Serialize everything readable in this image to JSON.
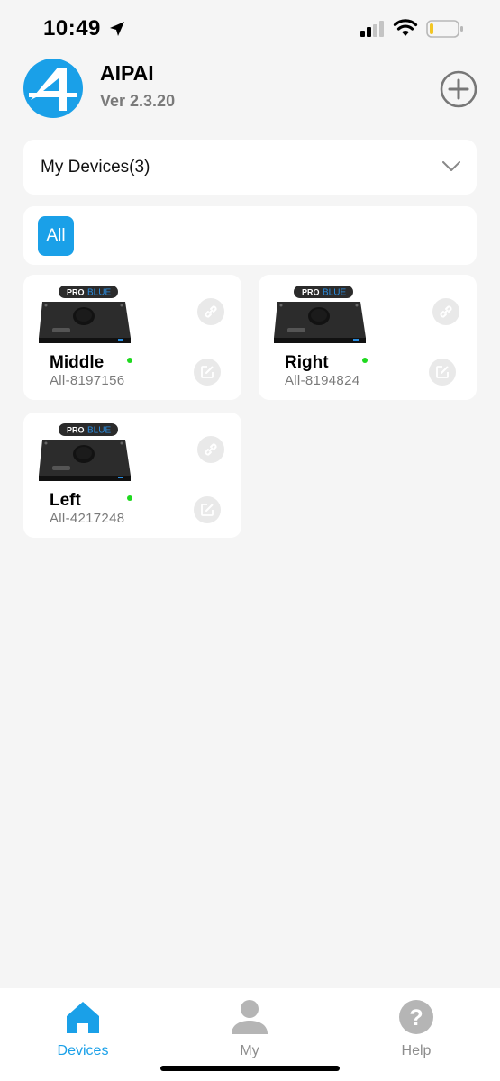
{
  "status_bar": {
    "time": "10:49",
    "icons": [
      "location-arrow-icon",
      "cellular-signal-icon",
      "wifi-icon",
      "battery-low-icon"
    ]
  },
  "header": {
    "app_name": "AIPAI",
    "version": "Ver 2.3.20",
    "logo_icon": "aipai-logo-icon",
    "add_icon": "plus-circle-icon"
  },
  "devices_dropdown": {
    "label": "My Devices(3)",
    "icon": "chevron-down-icon"
  },
  "filter": {
    "chips": [
      {
        "label": "All",
        "selected": true
      }
    ]
  },
  "devices": [
    {
      "name": "Middle",
      "id": "All-8197156",
      "online": true,
      "badge_left": "PRO",
      "badge_right": "BLUE"
    },
    {
      "name": "Right",
      "id": "All-8194824",
      "online": true,
      "badge_left": "PRO",
      "badge_right": "BLUE"
    },
    {
      "name": "Left",
      "id": "All-4217248",
      "online": true,
      "badge_left": "PRO",
      "badge_right": "BLUE"
    }
  ],
  "tab_bar": {
    "tabs": [
      {
        "label": "Devices",
        "icon": "home-icon",
        "active": true
      },
      {
        "label": "My",
        "icon": "user-icon",
        "active": false
      },
      {
        "label": "Help",
        "icon": "question-icon",
        "active": false
      }
    ]
  },
  "colors": {
    "accent": "#1aa0e8",
    "online": "#1fd91f",
    "inactive_tab": "#b5b5b5",
    "background": "#f5f5f5"
  }
}
